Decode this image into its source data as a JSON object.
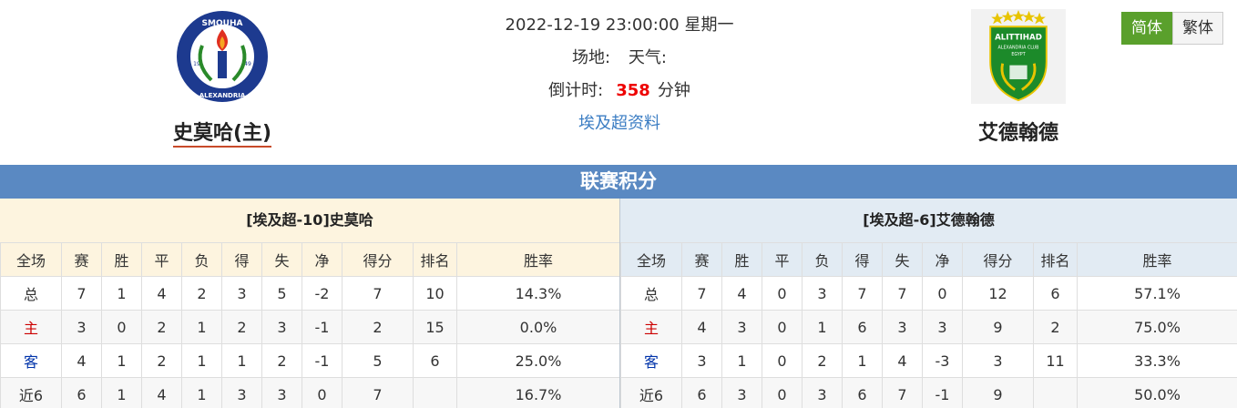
{
  "match": {
    "datetime": "2022-12-19 23:00:00",
    "weekday": "星期一",
    "venue_label": "场地:",
    "weather_label": "天气:",
    "countdown_label": "倒计时:",
    "countdown_value": "358",
    "countdown_unit": "分钟",
    "league_link": "埃及超资料"
  },
  "home_team": {
    "name": "史莫哈(主)",
    "logo_text_top": "SMOUHA",
    "logo_text_bottom": "ALEXANDRIA",
    "logo_year_left": "19",
    "logo_year_right": "49"
  },
  "away_team": {
    "name": "艾德翰德",
    "logo_text": "ALITTIHAD",
    "logo_sub": "ALEXANDRIA CLUB",
    "logo_country": "EGYPT"
  },
  "lang": {
    "simplified": "简体",
    "traditional": "繁体"
  },
  "section_title": "联赛积分",
  "columns": [
    "全场",
    "赛",
    "胜",
    "平",
    "负",
    "得",
    "失",
    "净",
    "得分",
    "排名",
    "胜率"
  ],
  "home_table": {
    "title": "[埃及超-10]史莫哈",
    "rows": [
      [
        "总",
        "7",
        "1",
        "4",
        "2",
        "3",
        "5",
        "-2",
        "7",
        "10",
        "14.3%"
      ],
      [
        "主",
        "3",
        "0",
        "2",
        "1",
        "2",
        "3",
        "-1",
        "2",
        "15",
        "0.0%"
      ],
      [
        "客",
        "4",
        "1",
        "2",
        "1",
        "1",
        "2",
        "-1",
        "5",
        "6",
        "25.0%"
      ],
      [
        "近6",
        "6",
        "1",
        "4",
        "1",
        "3",
        "3",
        "0",
        "7",
        "",
        "16.7%"
      ]
    ]
  },
  "away_table": {
    "title": "[埃及超-6]艾德翰德",
    "rows": [
      [
        "总",
        "7",
        "4",
        "0",
        "3",
        "7",
        "7",
        "0",
        "12",
        "6",
        "57.1%"
      ],
      [
        "主",
        "4",
        "3",
        "0",
        "1",
        "6",
        "3",
        "3",
        "9",
        "2",
        "75.0%"
      ],
      [
        "客",
        "3",
        "1",
        "0",
        "2",
        "1",
        "4",
        "-3",
        "3",
        "11",
        "33.3%"
      ],
      [
        "近6",
        "6",
        "3",
        "0",
        "3",
        "6",
        "7",
        "-1",
        "9",
        "",
        "50.0%"
      ]
    ]
  }
}
